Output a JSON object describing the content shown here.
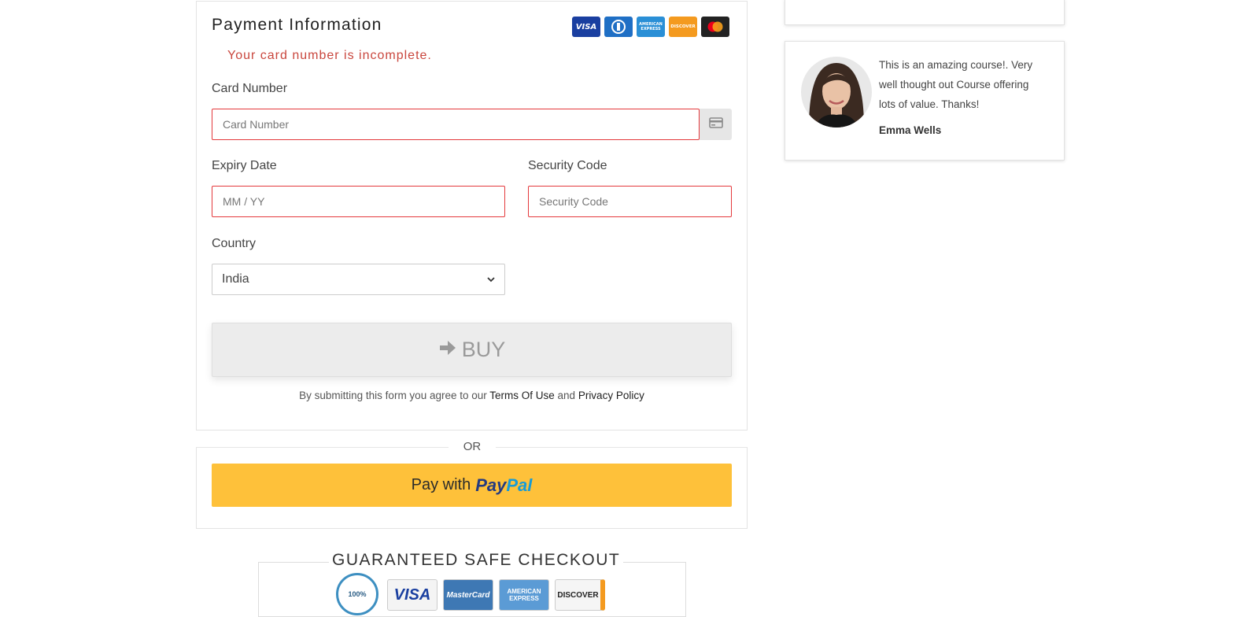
{
  "payment": {
    "title": "Payment Information",
    "error": "Your card number is incomplete.",
    "card_logos": {
      "visa": "VISA",
      "amex": "AMERICAN EXPRESS",
      "discover": "DISCOVER"
    },
    "card_number": {
      "label": "Card Number",
      "placeholder": "Card Number",
      "value": ""
    },
    "expiry": {
      "label": "Expiry Date",
      "placeholder": "MM / YY",
      "value": ""
    },
    "security": {
      "label": "Security Code",
      "placeholder": "Security Code",
      "value": ""
    },
    "country": {
      "label": "Country",
      "selected": "India"
    },
    "buy_label": "BUY",
    "terms": {
      "prefix": "By submitting this form you agree to our ",
      "terms_link": "Terms Of Use",
      "mid": " and ",
      "privacy_link": "Privacy Policy"
    },
    "colors": {
      "error": "#c9463d",
      "field_border_error": "#e4393c"
    }
  },
  "or_text": "OR",
  "paypal": {
    "with_text": "Pay with",
    "logo_pay": "Pay",
    "logo_pal": "Pal",
    "colors": {
      "button": "#fec13a",
      "pay": "#253b80",
      "pal": "#179bd7"
    }
  },
  "safe_checkout": {
    "title": "GUARANTEED SAFE CHECKOUT",
    "seal_text": "100%",
    "logos": {
      "visa": "VISA",
      "mastercard": "MasterCard",
      "amex": "AMERICAN EXPRESS",
      "discover": "DISCOVER"
    }
  },
  "testimonial": {
    "quote": "This is an amazing course!. Very well thought out Course offering lots of value. Thanks!",
    "author": "Emma Wells"
  }
}
